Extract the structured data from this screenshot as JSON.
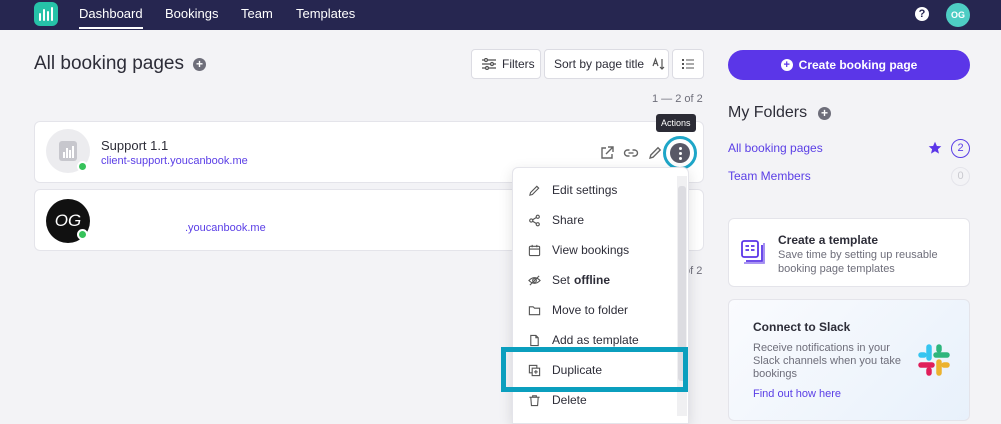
{
  "nav": {
    "links": [
      "Dashboard",
      "Bookings",
      "Team",
      "Templates"
    ],
    "help_symbol": "?",
    "avatar_initials": "OG"
  },
  "header": {
    "title": "All booking pages",
    "filters_label": "Filters",
    "sort_label": "Sort by page title",
    "count_top": "1 — 2 of 2",
    "count_bottom": "of 2"
  },
  "cards": [
    {
      "title": "Support 1.1",
      "url": "client-support.youcanbook.me",
      "status": "online"
    },
    {
      "title": "",
      "url": ".youcanbook.me",
      "avatar_text": "OG",
      "status": "online"
    }
  ],
  "tooltip": "Actions",
  "dropdown": {
    "items": [
      {
        "label": "Edit settings",
        "icon": "pencil-icon"
      },
      {
        "label": "Share",
        "icon": "share-icon"
      },
      {
        "label": "View bookings",
        "icon": "calendar-icon"
      },
      {
        "label": "Set",
        "bold": "offline",
        "icon": "eye-off-icon"
      },
      {
        "label": "Move to folder",
        "icon": "folder-icon"
      },
      {
        "label": "Add as template",
        "icon": "document-icon"
      },
      {
        "label": "Duplicate",
        "icon": "duplicate-icon"
      },
      {
        "label": "Delete",
        "icon": "trash-icon"
      }
    ]
  },
  "sidebar": {
    "create_label": "Create booking page",
    "folders_title": "My Folders",
    "folders": [
      {
        "label": "All booking pages",
        "count": "2",
        "starred": true
      },
      {
        "label": "Team Members",
        "count": "0",
        "starred": false
      }
    ],
    "template_card": {
      "title": "Create a template",
      "description": "Save time by setting up reusable booking page templates"
    },
    "slack_card": {
      "title": "Connect to Slack",
      "description": "Receive notifications in your Slack channels when you take bookings",
      "link": "Find out how here"
    }
  },
  "colors": {
    "nav_bg": "#262650",
    "accent": "#5b36e8",
    "highlight": "#0b9fbe",
    "online": "#36c25a"
  }
}
